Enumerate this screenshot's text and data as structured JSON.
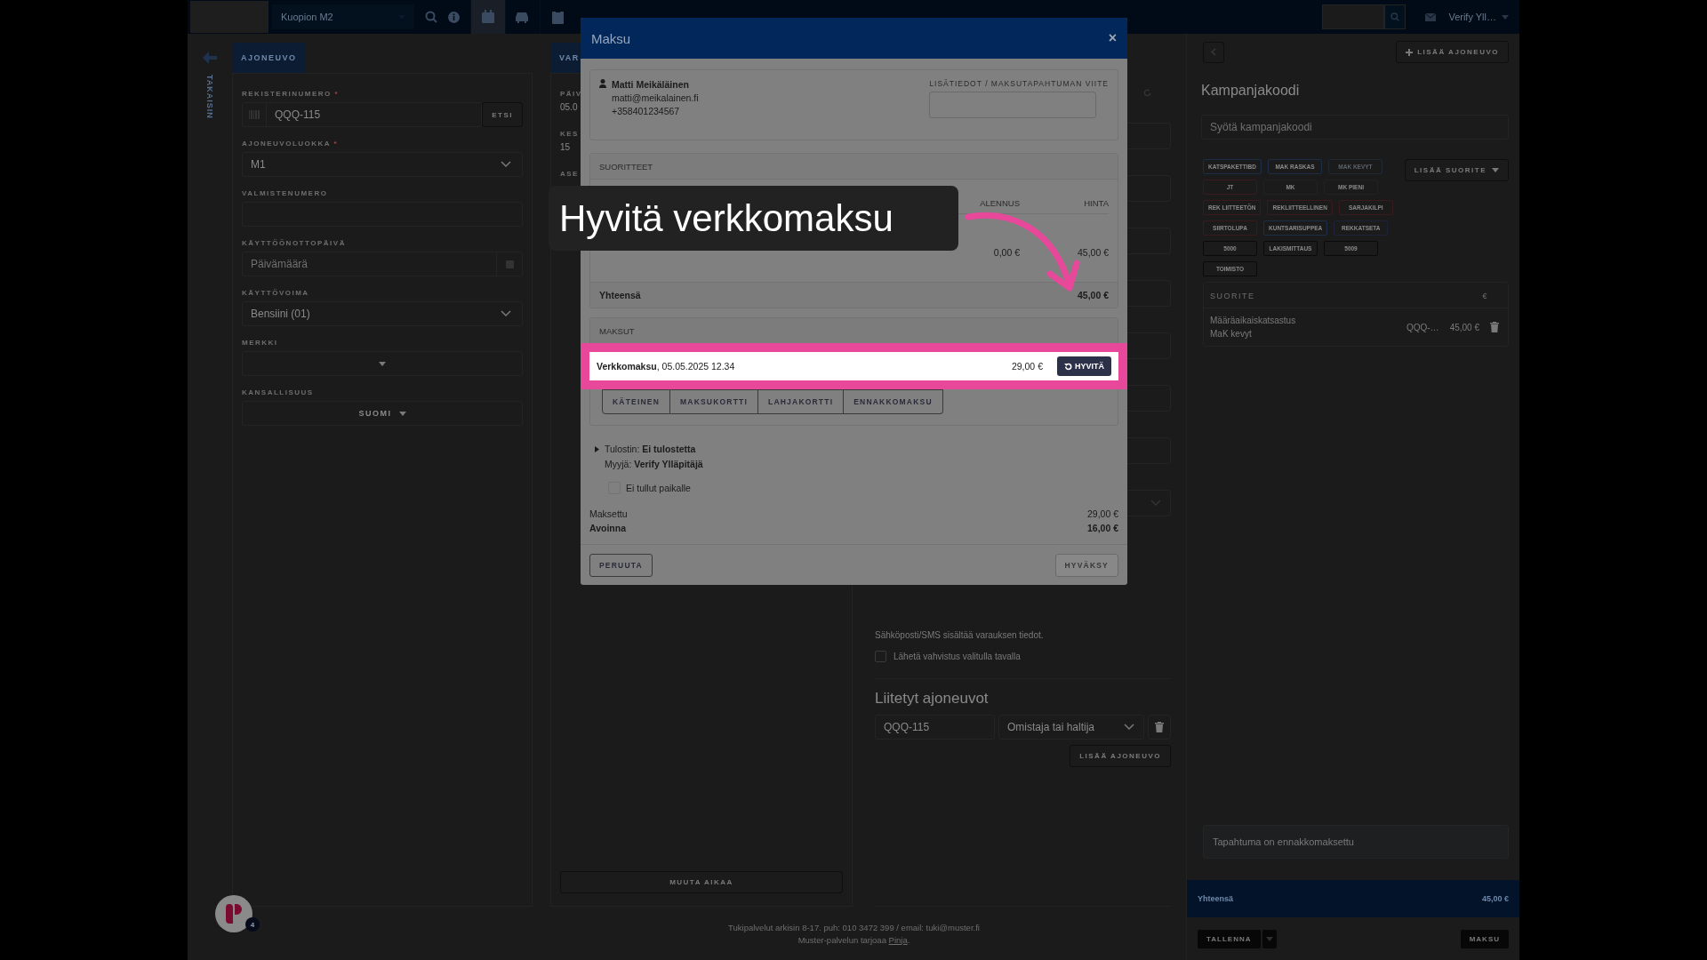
{
  "topbar": {
    "location": "Kuopion M2",
    "user": "Verify Yll…",
    "nav_icons": [
      {
        "kind": "calendar",
        "selected": true
      },
      {
        "kind": "car",
        "selected": false
      },
      {
        "kind": "clipboard",
        "selected": false
      }
    ]
  },
  "sidebar": {
    "back_label": "TAKAISIN"
  },
  "vehicle_form": {
    "tab": "AJONEUVO",
    "fields": [
      {
        "label": "REKISTERINUMERO",
        "required_mark": "*",
        "kind": "search",
        "value": "QQQ-115",
        "button": "ETSI"
      },
      {
        "label": "AJONEUVOLUOKKA",
        "required_mark": "*",
        "kind": "select",
        "value": "M1"
      },
      {
        "label": "VALMISTENUMERO",
        "kind": "text"
      },
      {
        "label": "KÄYTTÖÖNOTTOPÄIVÄ",
        "kind": "date",
        "placeholder": "Päivämäärä"
      },
      {
        "label": "KÄYTTÖVOIMA",
        "kind": "select",
        "value": "Bensiini (01)"
      },
      {
        "label": "MERKKI",
        "kind": "dropdown"
      },
      {
        "label": "KANSALLISUUS",
        "kind": "dropdown",
        "value": "SUOMI"
      }
    ]
  },
  "booking": {
    "tab": "VAR",
    "fields": [
      {
        "label": "PÄIV",
        "value": "05.0"
      },
      {
        "label": "KES",
        "value": "15"
      },
      {
        "label": "ASE"
      }
    ],
    "button": "MUUTA AIKAA"
  },
  "customer_column": {
    "notice": "Sähköposti/SMS sisältää varauksen tiedot.",
    "confirm": {
      "label": "Lähetä vahvistus valitulla tavalla",
      "checked": false
    },
    "linked_title": "Liitetyt ajoneuvot",
    "linked_vehicle": {
      "plate": "QQQ-115",
      "role": "Omistaja tai haltija"
    },
    "add_button": "LISÄÄ AJONEUVO"
  },
  "campaign_panel": {
    "add_vehicle": "LISÄÄ AJONEUVO",
    "title": "Kampanjakoodi",
    "placeholder": "Syötä kampanjakoodi",
    "add_service": "LISÄÄ SUORITE",
    "tags": [
      {
        "label": "KATSPAKETTIBD",
        "color": "#1c2e48",
        "disabled": false
      },
      {
        "label": "MAK RASKAS",
        "color": "#1c2e48",
        "disabled": false
      },
      {
        "label": "MAK KEVYT",
        "color": "#1e2a36",
        "disabled": true
      },
      {
        "label": "JT",
        "color": "#3a1a1e",
        "disabled": false
      },
      {
        "label": "MK",
        "color": "#222222",
        "disabled": false
      },
      {
        "label": "MK PIENI",
        "color": "#222222",
        "disabled": false
      },
      {
        "label": "REK LIITTEETÖN",
        "color": "#3a1a1e",
        "disabled": false
      },
      {
        "label": "REKLIITTEELLINEN",
        "color": "#3a1a1e",
        "disabled": false
      },
      {
        "label": "SARJAKILPI",
        "color": "#3a1a1e",
        "disabled": false
      },
      {
        "label": "SIIRTOLUPA",
        "color": "#3a1a1e",
        "disabled": false
      },
      {
        "label": "KUNTSARISUPPEA",
        "color": "#1c2e48",
        "disabled": false
      },
      {
        "label": "REKKATSETA",
        "color": "#1e2238",
        "disabled": false
      },
      {
        "label": "5000",
        "color": "#0a0a0a",
        "disabled": false
      },
      {
        "label": "LAKISMITTAUS",
        "color": "#0a0a0a",
        "disabled": false
      },
      {
        "label": "5009",
        "color": "#0a0a0a",
        "disabled": false
      },
      {
        "label": "TOIMISTO",
        "color": "#0a0a0a",
        "disabled": false
      }
    ],
    "table": {
      "columns": [
        "SUORITE",
        "€"
      ],
      "rows": [
        {
          "service": "Määräaikaiskatsastus",
          "detail": "MaK kevyt",
          "plate": "QQQ-…",
          "price": "45,00 €"
        }
      ]
    },
    "note": "Tapahtuma on ennakkomaksettu",
    "total_label": "Yhteensä",
    "total": "45,00 €",
    "save": "TALLENNA",
    "pay": "MAKSU"
  },
  "footer": {
    "support": "Tukipalvelut arkisin 8-17. puh: 010 3472 399 / email: tuki@muster.fi",
    "provider": "Muster-palvelun tarjoaa",
    "provider_link": "Pinja",
    "provider_end": "."
  },
  "chat": {
    "badge": "4"
  },
  "modal": {
    "title": "Maksu",
    "close": "×",
    "customer": {
      "name": "Matti Meikäläinen",
      "email": "matti@meikalainen.fi",
      "phone": "+358401234567"
    },
    "reference_label": "LISÄTIEDOT / MAKSUTAPAHTUMAN VIITE",
    "services": {
      "title": "SUORITTEET",
      "columns": [
        "ALENNUS",
        "HINTA"
      ],
      "rows": [
        {
          "discount": "0,00 €",
          "price": "45,00 €"
        }
      ],
      "total_label": "Yhteensä",
      "total": "45,00 €"
    },
    "payments": {
      "title": "MAKSUT",
      "items": [
        {
          "text": "**Verkkomaksu**, 05.05.2025 12.34",
          "amount": "29,00 €",
          "action": "HYVITÄ",
          "highlighted": true
        }
      ],
      "methods": [
        "KÄTEINEN",
        "MAKSUKORTTI",
        "LAHJAKORTTI",
        "ENNAKKOMAKSU"
      ]
    },
    "printer": "Tulostin: **Ei tulostetta**",
    "seller": "Myyjä: **Verify Ylläpitäjä**",
    "no_show": {
      "label": "Ei tullut paikalle",
      "checked": false
    },
    "summary": [
      {
        "label": "Maksettu",
        "value": "29,00 €",
        "bold": false
      },
      {
        "label": "Avoinna",
        "value": "16,00 €",
        "bold": true
      }
    ],
    "cancel": "PERUUTA",
    "accept": {
      "label": "HYVÄKSY",
      "disabled": true
    }
  },
  "tutorial": {
    "caption": "Hyvitä verkkomaksu"
  }
}
